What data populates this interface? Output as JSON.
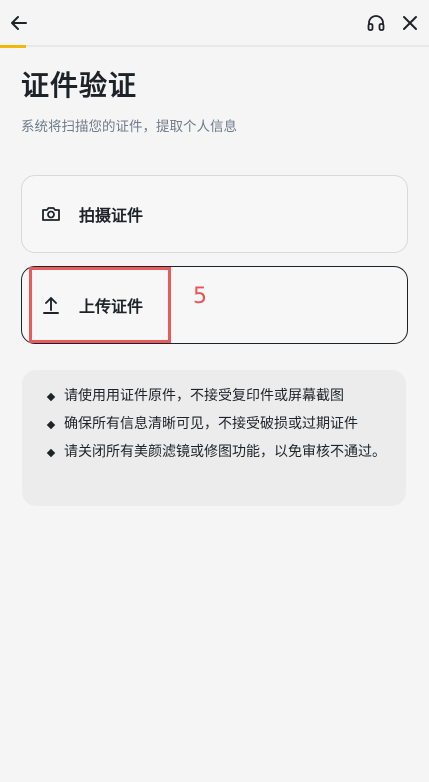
{
  "header": {
    "back_icon": "arrow-left-icon",
    "support_icon": "headset-icon",
    "close_icon": "close-icon",
    "progress": 0.06,
    "accent_color": "#f0b90b"
  },
  "page": {
    "title": "证件验证",
    "subtitle": "系统将扫描您的证件，提取个人信息"
  },
  "options": {
    "capture": {
      "label": "拍摄证件",
      "icon": "camera-icon"
    },
    "upload": {
      "label": "上传证件",
      "icon": "upload-icon"
    }
  },
  "annotation": {
    "label": "5",
    "color": "#e85454"
  },
  "notes": [
    "请使用用证件原件，不接受复印件或屏幕截图",
    "确保所有信息清晰可见，不接受破损或过期证件",
    "请关闭所有美颜滤镜或修图功能，以免审核不通过。"
  ]
}
